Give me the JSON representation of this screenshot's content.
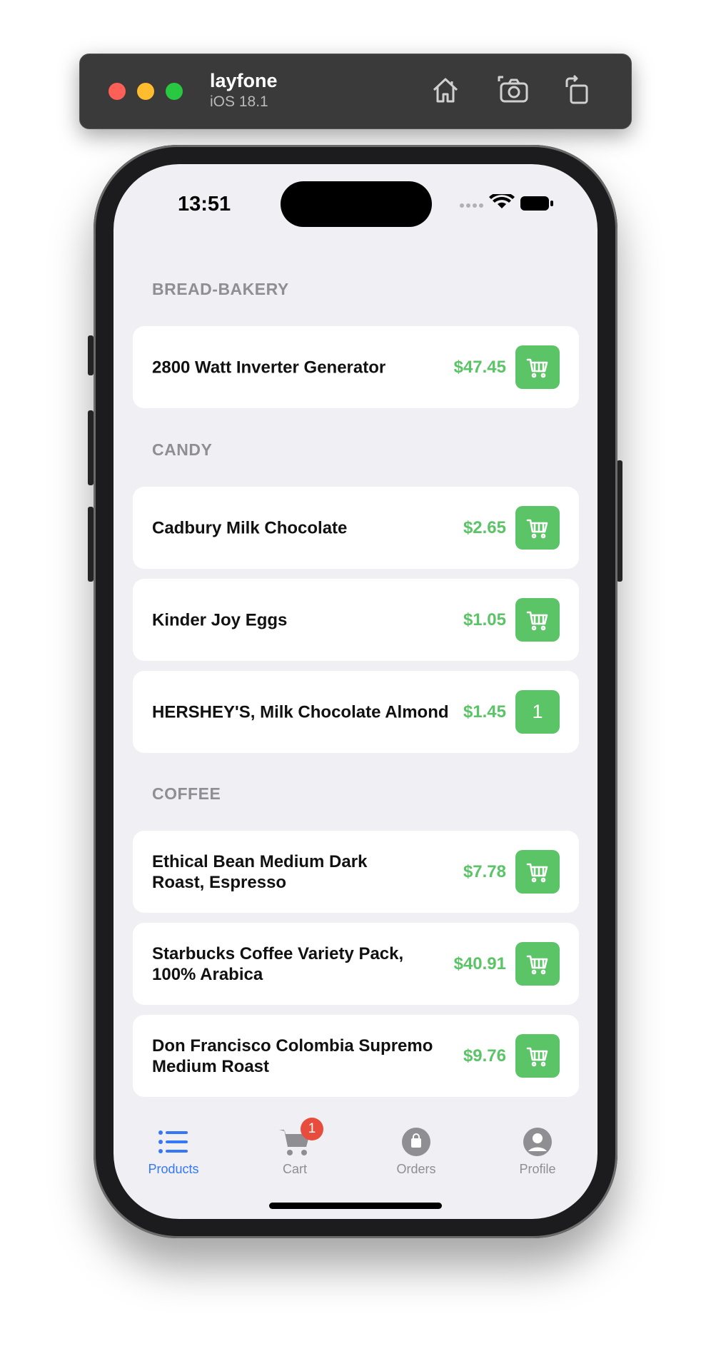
{
  "simulator": {
    "app_name": "layfone",
    "os_version": "iOS 18.1",
    "toolbar_icons": [
      "home-icon",
      "screenshot-icon",
      "rotate-icon"
    ]
  },
  "status_bar": {
    "time": "13:51",
    "icons": [
      "cellular-icon",
      "wifi-icon",
      "battery-icon"
    ]
  },
  "sections": [
    {
      "title": "BREAD-BAKERY",
      "items": [
        {
          "name": "2800 Watt Inverter Generator",
          "price": "$47.45",
          "action": "cart"
        }
      ]
    },
    {
      "title": "CANDY",
      "items": [
        {
          "name": "Cadbury Milk Chocolate",
          "price": "$2.65",
          "action": "cart"
        },
        {
          "name": "Kinder Joy Eggs",
          "price": "$1.05",
          "action": "cart"
        },
        {
          "name": "HERSHEY'S, Milk Chocolate Almond",
          "price": "$1.45",
          "action": "quantity",
          "quantity": "1"
        }
      ]
    },
    {
      "title": "COFFEE",
      "items": [
        {
          "name": "Ethical Bean Medium Dark Roast, Espresso",
          "price": "$7.78",
          "action": "cart"
        },
        {
          "name": "Starbucks Coffee Variety Pack, 100% Arabica",
          "price": "$40.91",
          "action": "cart"
        },
        {
          "name": "Don Francisco Colombia Supremo Medium Roast",
          "price": "$9.76",
          "action": "cart"
        }
      ]
    }
  ],
  "tab_bar": {
    "tabs": [
      {
        "label": "Products",
        "icon": "list-icon",
        "active": true
      },
      {
        "label": "Cart",
        "icon": "cart-icon",
        "badge": "1"
      },
      {
        "label": "Orders",
        "icon": "bag-icon"
      },
      {
        "label": "Profile",
        "icon": "person-icon"
      }
    ]
  },
  "colors": {
    "accent_green": "#5ac466",
    "active_tab_blue": "#3478f6",
    "badge_red": "#e74c3c",
    "background": "#efeff4"
  }
}
